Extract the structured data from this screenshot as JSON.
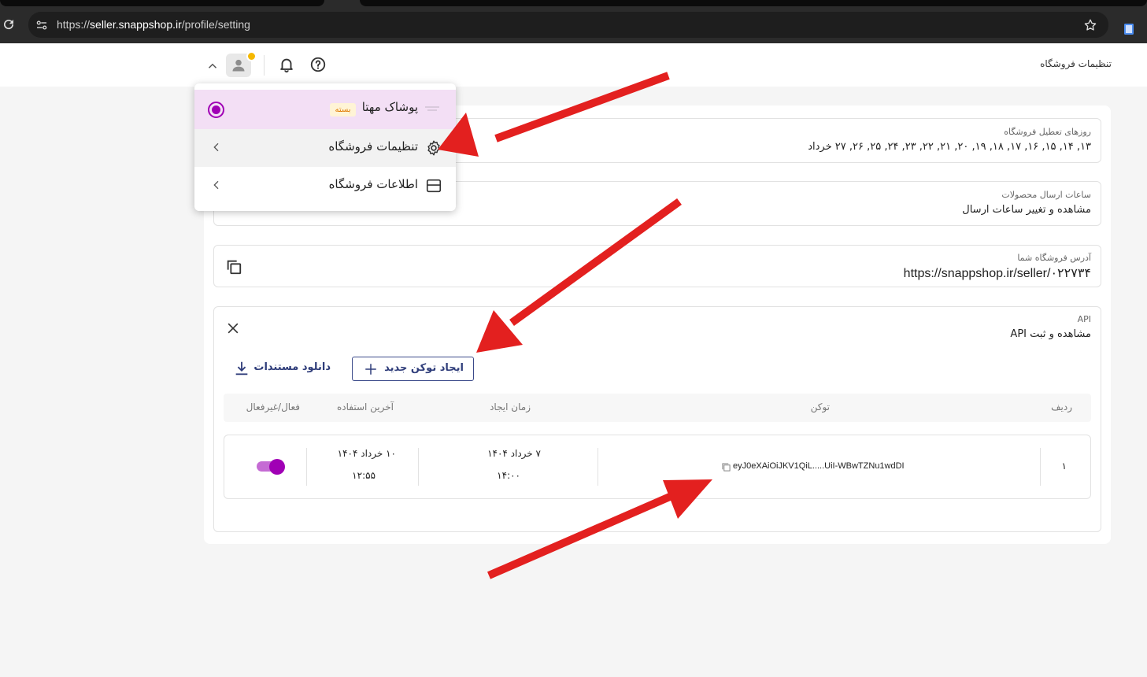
{
  "browser": {
    "url_scheme": "https://",
    "url_host": "seller.snappshop.ir",
    "url_path": "/profile/setting"
  },
  "header": {
    "title": "تنظیمات فروشگاه"
  },
  "dropdown": {
    "shop_name": "پوشاک مهتا",
    "shop_status": "بسته",
    "items": [
      {
        "label": "تنظیمات فروشگاه"
      },
      {
        "label": "اطلاعات فروشگاه"
      }
    ]
  },
  "settings": {
    "closure_days": {
      "label": "روزهای تعطیل فروشگاه",
      "value": "۱۳, ۱۴, ۱۵, ۱۶, ۱۷, ۱۸, ۱۹, ۲۰, ۲۱, ۲۲, ۲۳, ۲۴, ۲۵, ۲۶, ۲۷ خرداد"
    },
    "shipping_hours": {
      "label": "ساعات ارسال محصولات",
      "value": "مشاهده و تغییر ساعات ارسال"
    },
    "shop_address": {
      "label": "آدرس فروشگاه شما",
      "value": "https://snappshop.ir/seller/۰۲۲۷۳۴"
    },
    "api": {
      "label": "API",
      "value": "مشاهده و ثبت API",
      "create_token": "ایجاد توکن جدید",
      "download_docs": "دانلود مستندات",
      "columns": [
        "ردیف",
        "توکن",
        "زمان ایجاد",
        "آخرین استفاده",
        "فعال/غیرفعال"
      ],
      "rows": [
        {
          "index": "۱",
          "token": "eyJ0eXAiOiJKV1QiL.....UiI-WBwTZNu1wdDI",
          "created_date": "۷ خرداد ۱۴۰۴",
          "created_time": "۱۴:۰۰",
          "last_used_date": "۱۰ خرداد ۱۴۰۴",
          "last_used_time": "۱۲:۵۵",
          "active": true
        }
      ]
    }
  },
  "colors": {
    "accent": "#a000b5",
    "primary_text": "#2f3d7a",
    "annotation_arrow": "#e3201f",
    "badge_text": "#e07a00"
  }
}
